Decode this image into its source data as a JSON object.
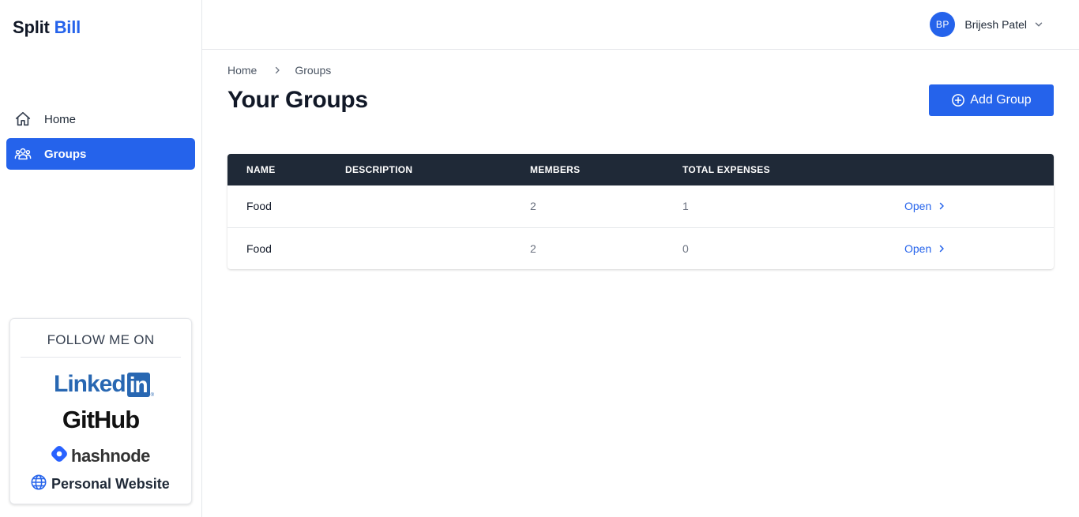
{
  "app": {
    "logo_main": "Split",
    "logo_accent": "Bill"
  },
  "sidebar": {
    "items": [
      {
        "label": "Home",
        "icon": "home-icon",
        "active": false
      },
      {
        "label": "Groups",
        "icon": "users-icon",
        "active": true
      }
    ],
    "follow": {
      "title": "FOLLOW ME ON",
      "linkedin_text": "Linked",
      "linkedin_box": "in",
      "linkedin_reg": "®",
      "github": "GitHub",
      "hashnode": "hashnode",
      "website": "Personal Website"
    }
  },
  "header": {
    "user_initials": "BP",
    "user_name": "Brijesh Patel"
  },
  "breadcrumb": {
    "home": "Home",
    "current": "Groups"
  },
  "main": {
    "title": "Your Groups",
    "add_button": "Add Group",
    "table": {
      "columns": [
        "NAME",
        "DESCRIPTION",
        "MEMBERS",
        "TOTAL EXPENSES",
        ""
      ],
      "rows": [
        {
          "name": "Food",
          "description": "",
          "members": "2",
          "total_expenses": "1",
          "action": "Open"
        },
        {
          "name": "Food",
          "description": "",
          "members": "2",
          "total_expenses": "0",
          "action": "Open"
        }
      ]
    }
  },
  "colors": {
    "primary": "#2563eb",
    "table_header": "#1f2937",
    "linkedin": "#2867b2",
    "hashnode": "#2962ff"
  }
}
